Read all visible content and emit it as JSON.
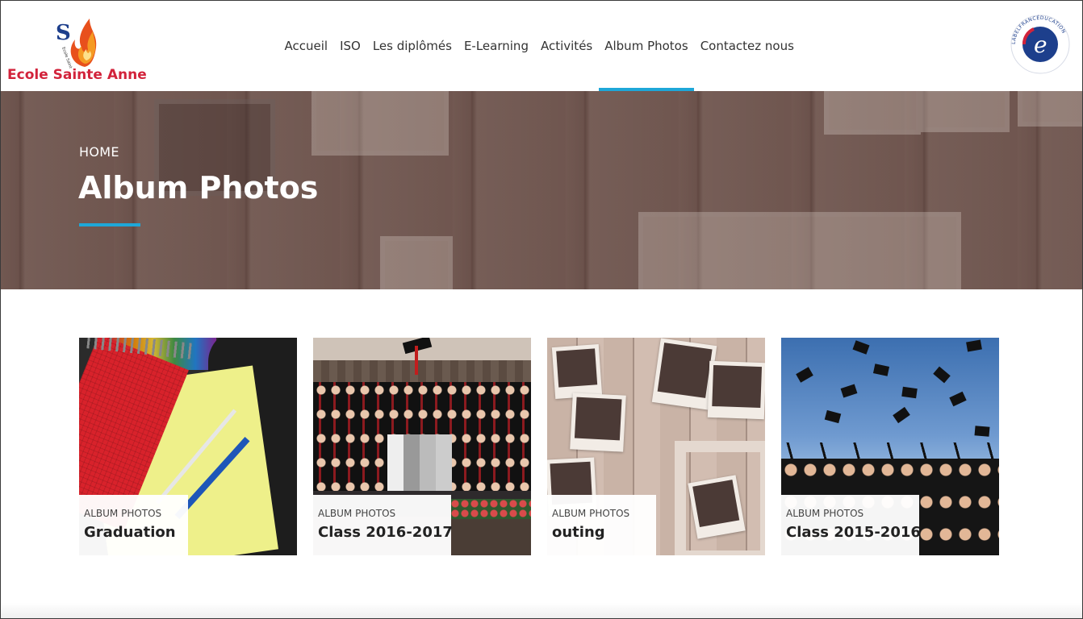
{
  "site": {
    "name": "Ecole Sainte Anne",
    "logo_icon": "school-flame-logo",
    "accent_color": "#1ea7d8",
    "brand_color": "#d2233b"
  },
  "nav": {
    "items": [
      {
        "label": "Accueil",
        "active": false
      },
      {
        "label": "ISO",
        "active": false
      },
      {
        "label": "Les diplômés",
        "active": false
      },
      {
        "label": "E-Learning",
        "active": false
      },
      {
        "label": "Activités",
        "active": false
      },
      {
        "label": "Album Photos",
        "active": true
      },
      {
        "label": "Contactez nous",
        "active": false
      }
    ]
  },
  "partner_logo": {
    "icon": "label-france-education-logo",
    "text": "LABELFRANCÉDUCATION"
  },
  "hero": {
    "breadcrumb": "HOME",
    "title": "Album Photos"
  },
  "albums": [
    {
      "category": "ALBUM PHOTOS",
      "title": "Graduation",
      "image": "notebooks-and-pens"
    },
    {
      "category": "ALBUM PHOTOS",
      "title": "Class 2016-2017",
      "image": "graduation-class-photo"
    },
    {
      "category": "ALBUM PHOTOS",
      "title": "outing",
      "image": "photos-on-wooden-wall"
    },
    {
      "category": "ALBUM PHOTOS",
      "title": "Class 2015-2016",
      "image": "graduation-caps-thrown"
    }
  ]
}
